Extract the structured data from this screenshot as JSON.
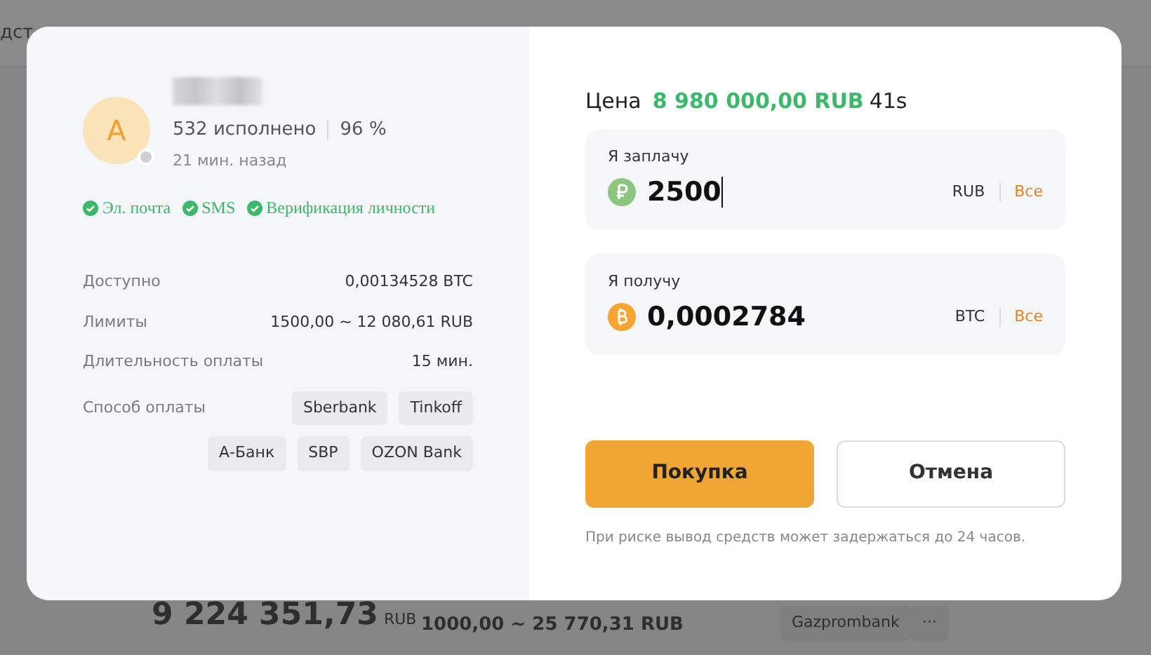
{
  "background": {
    "header_fragment": "дст",
    "balance": "9 224 351,73",
    "balance_currency": "RUB",
    "limits": "1000,00 ~ 25 770,31 RUB",
    "payment_method": "Gazprombank",
    "more_button": "···"
  },
  "seller": {
    "avatar_letter": "A",
    "online": false,
    "completed": "532 исполнено",
    "rate": "96 %",
    "last_seen": "21 мин. назад",
    "verifications": [
      "Эл. почта",
      "SMS",
      "Верификация личности"
    ]
  },
  "details": [
    {
      "label": "Доступно",
      "value": "0,00134528 BTC"
    },
    {
      "label": "Лимиты",
      "value": "1500,00 ~ 12 080,61 RUB"
    },
    {
      "label": "Длительность оплаты",
      "value": "15 мин."
    }
  ],
  "payment": {
    "label": "Способ оплаты",
    "methods": [
      "Sberbank",
      "Tinkoff",
      "А-Банк",
      "SBP",
      "OZON Bank"
    ]
  },
  "price": {
    "label": "Цена",
    "value": "8 980 000,00 RUB",
    "timer": "41s"
  },
  "fields": [
    {
      "label": "Я заплачу",
      "value": "2500",
      "currency": "RUB",
      "kind": "rub",
      "all": "Все",
      "focused": true
    },
    {
      "label": "Я получу",
      "value": "0,0002784",
      "currency": "BTC",
      "kind": "btc",
      "all": "Все",
      "focused": false
    }
  ],
  "buttons": [
    {
      "label": "Покупка",
      "kind": "primary"
    },
    {
      "label": "Отмена",
      "kind": "secondary"
    }
  ],
  "note": "При риске вывод средств может задержаться до 24 часов."
}
